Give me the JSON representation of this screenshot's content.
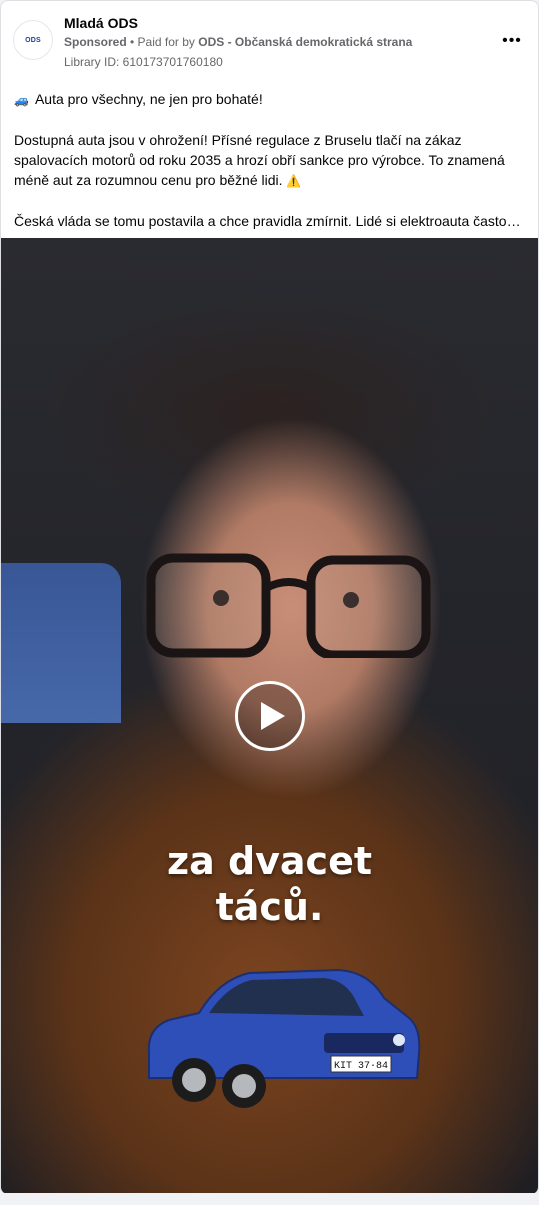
{
  "post": {
    "page_name": "Mladá ODS",
    "avatar_text": "ODS",
    "sponsored": "Sponsored",
    "paid_for_prefix": " • Paid for by ",
    "paid_for_name": "ODS - Občanská demokratická strana",
    "library_id": "Library ID: 610173701760180",
    "more_label": "•••"
  },
  "body": {
    "line1_emoji": "🚙",
    "line1": "Auta pro všechny, ne jen pro bohaté!",
    "para2": "Dostupná auta jsou v ohrožení! Přísné regulace z Bruselu tlačí na zákaz spalovacích motorů od roku 2035 a hrozí obří sankce pro výrobce. To znamená méně aut za rozumnou cenu pro běžné lidi.",
    "para2_emoji": "⚠️",
    "para3": "Česká vláda se tomu postavila a chce pravidla zmírnit. Lidé si elektroauta často…"
  },
  "video": {
    "caption_line1": "za dvacet",
    "caption_line2": "táců.",
    "license_plate": "KIT 37·84"
  },
  "colors": {
    "brand_blue": "#1c3f94",
    "meta_gray": "#65676b",
    "car_blue": "#2f4fb8"
  }
}
